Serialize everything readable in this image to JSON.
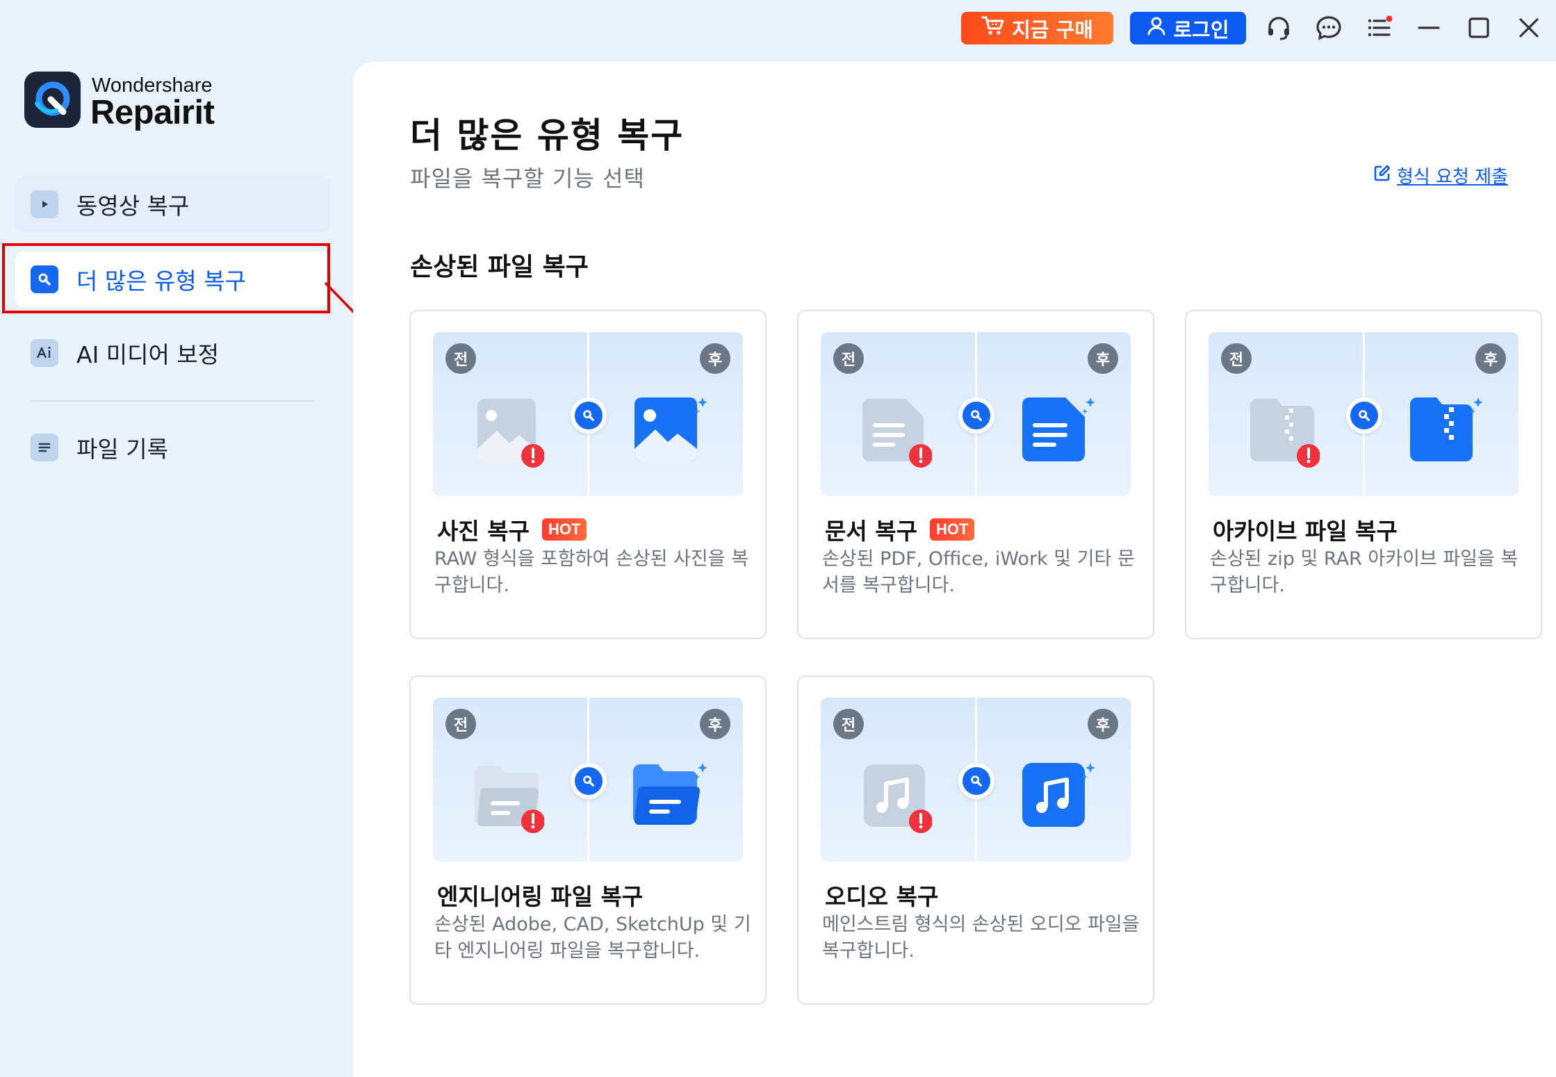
{
  "titlebar": {
    "buy_label": "지금 구매",
    "login_label": "로그인"
  },
  "brand": {
    "top": "Wondershare",
    "name": "Repairit"
  },
  "sidebar": {
    "items": [
      {
        "label": "동영상 복구",
        "icon": "play-icon"
      },
      {
        "label": "더 많은 유형 복구",
        "icon": "wrench-icon"
      },
      {
        "label": "AI 미디어 보정",
        "icon": "ai-icon"
      },
      {
        "label": "파일 기록",
        "icon": "list-icon"
      }
    ]
  },
  "main": {
    "title": "더 많은 유형 복구",
    "subtitle": "파일을 복구할 기능 선택",
    "request_link": "형식 요청 제출",
    "section_title": "손상된 파일 복구",
    "before_label": "전",
    "after_label": "후",
    "hot_label": "HOT",
    "cards": [
      {
        "title": "사진 복구",
        "hot": true,
        "desc": "RAW 형식을 포함하여 손상된 사진을 복구합니다."
      },
      {
        "title": "문서 복구",
        "hot": true,
        "desc": "손상된 PDF, Office, iWork 및 기타 문서를 복구합니다."
      },
      {
        "title": "아카이브 파일 복구",
        "hot": false,
        "desc": "손상된 zip 및 RAR 아카이브 파일을 복구합니다."
      },
      {
        "title": "엔지니어링 파일 복구",
        "hot": false,
        "desc": "손상된 Adobe, CAD, SketchUp 및 기타 엔지니어링 파일을 복구합니다."
      },
      {
        "title": "오디오 복구",
        "hot": false,
        "desc": "메인스트림 형식의 손상된 오디오 파일을 복구합니다."
      }
    ]
  },
  "colors": {
    "accent": "#0b5bf0",
    "buy": "#ff5a24",
    "highlight": "#e00000"
  }
}
